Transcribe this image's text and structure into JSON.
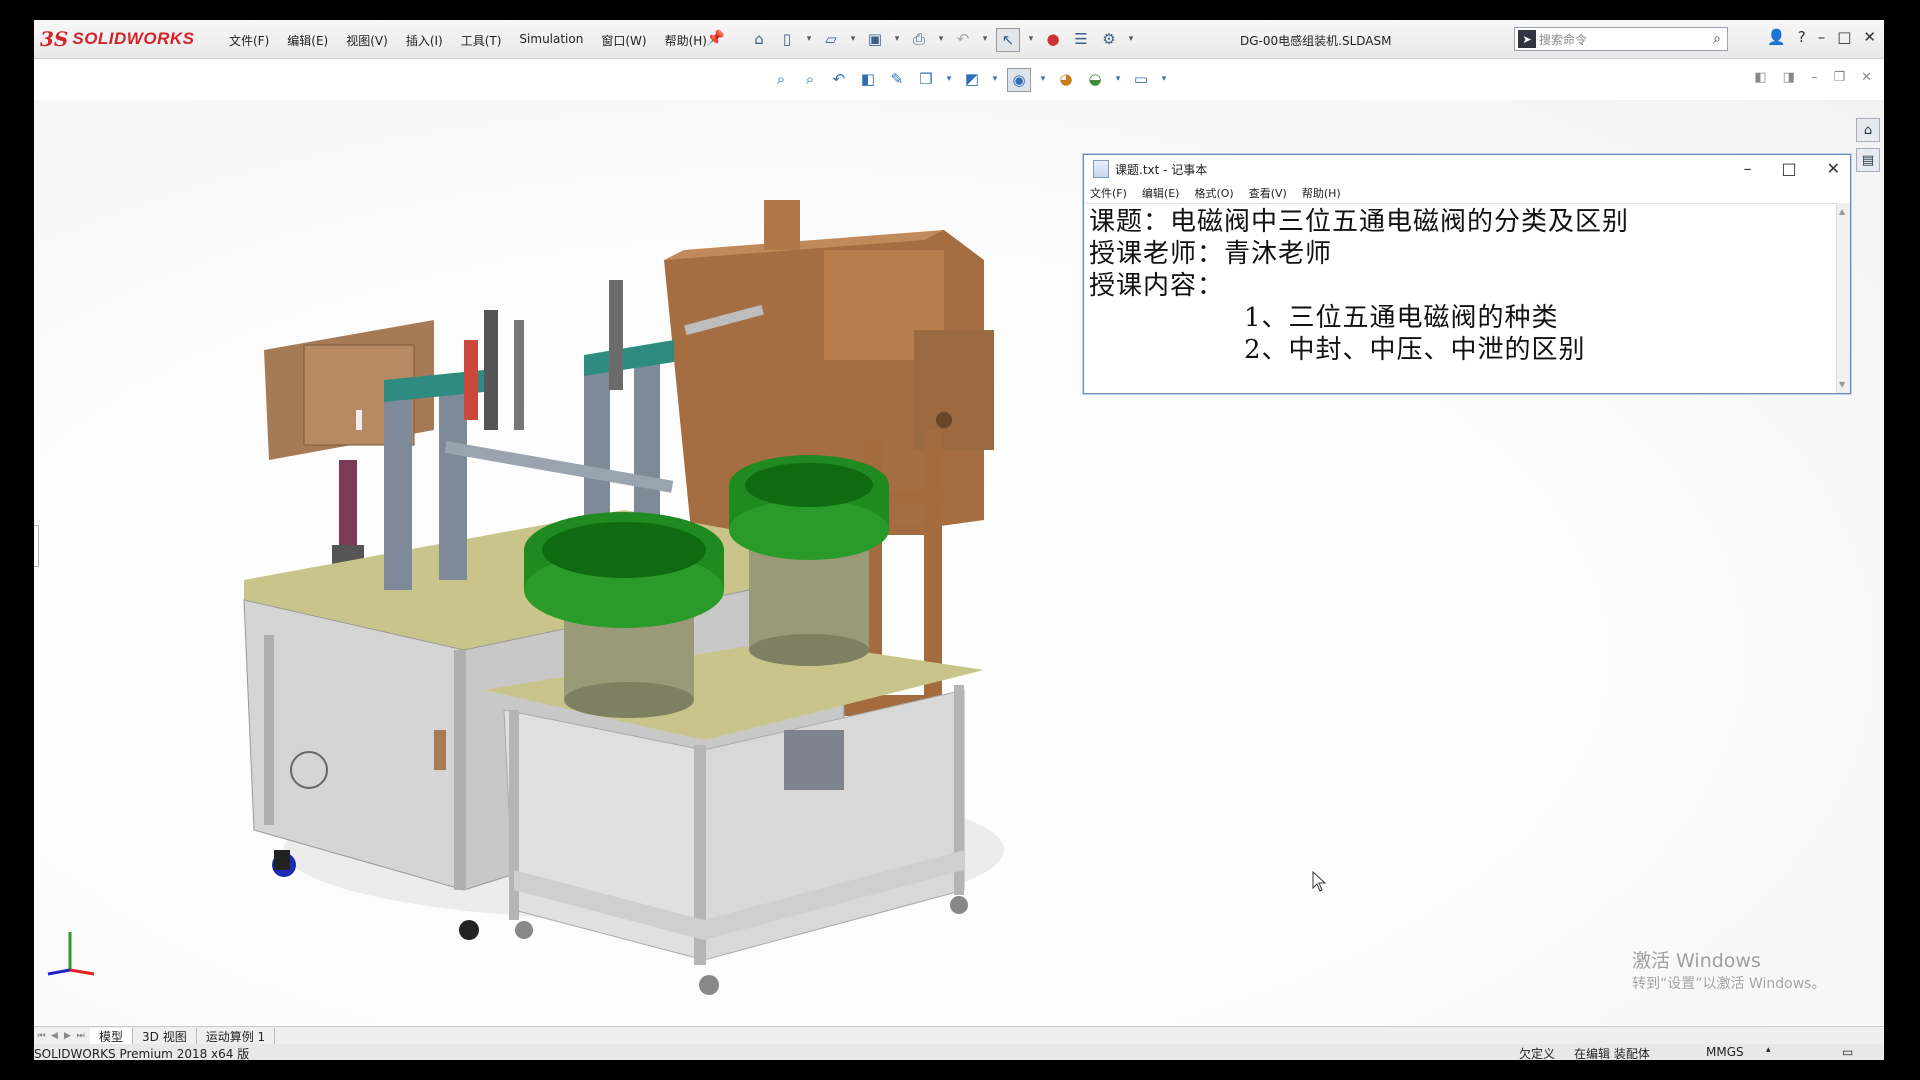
{
  "app": {
    "logo_mark": "3S",
    "logo_text": "SOLIDWORKS",
    "menu": [
      "文件(F)",
      "编辑(E)",
      "视图(V)",
      "插入(I)",
      "工具(T)",
      "Simulation",
      "窗口(W)",
      "帮助(H)"
    ],
    "document_title": "DG-00电感组装机.SLDASM",
    "search_placeholder": "搜索命令",
    "help_label": "?"
  },
  "notepad": {
    "title": "课题.txt - 记事本",
    "menu": [
      "文件(F)",
      "编辑(E)",
      "格式(O)",
      "查看(V)",
      "帮助(H)"
    ],
    "lines": [
      "课题：电磁阀中三位五通电磁阀的分类及区别",
      "授课老师：青沐老师",
      "授课内容：",
      "1、三位五通电磁阀的种类",
      "2、中封、中压、中泄的区别"
    ]
  },
  "watermark": {
    "line1": "激活 Windows",
    "line2": "转到“设置”以激活 Windows。"
  },
  "tabs": [
    "模型",
    "3D 视图",
    "运动算例 1"
  ],
  "status": {
    "version": "SOLIDWORKS Premium 2018 x64 版",
    "definition": "欠定义",
    "mode": "在编辑 装配体",
    "units": "MMGS"
  },
  "colors": {
    "brand": "#d2242a",
    "machine_wood": "#b07848",
    "machine_green": "#1f8a1f",
    "machine_teal": "#2e8b7f",
    "machine_yellow": "#c9c58a"
  }
}
